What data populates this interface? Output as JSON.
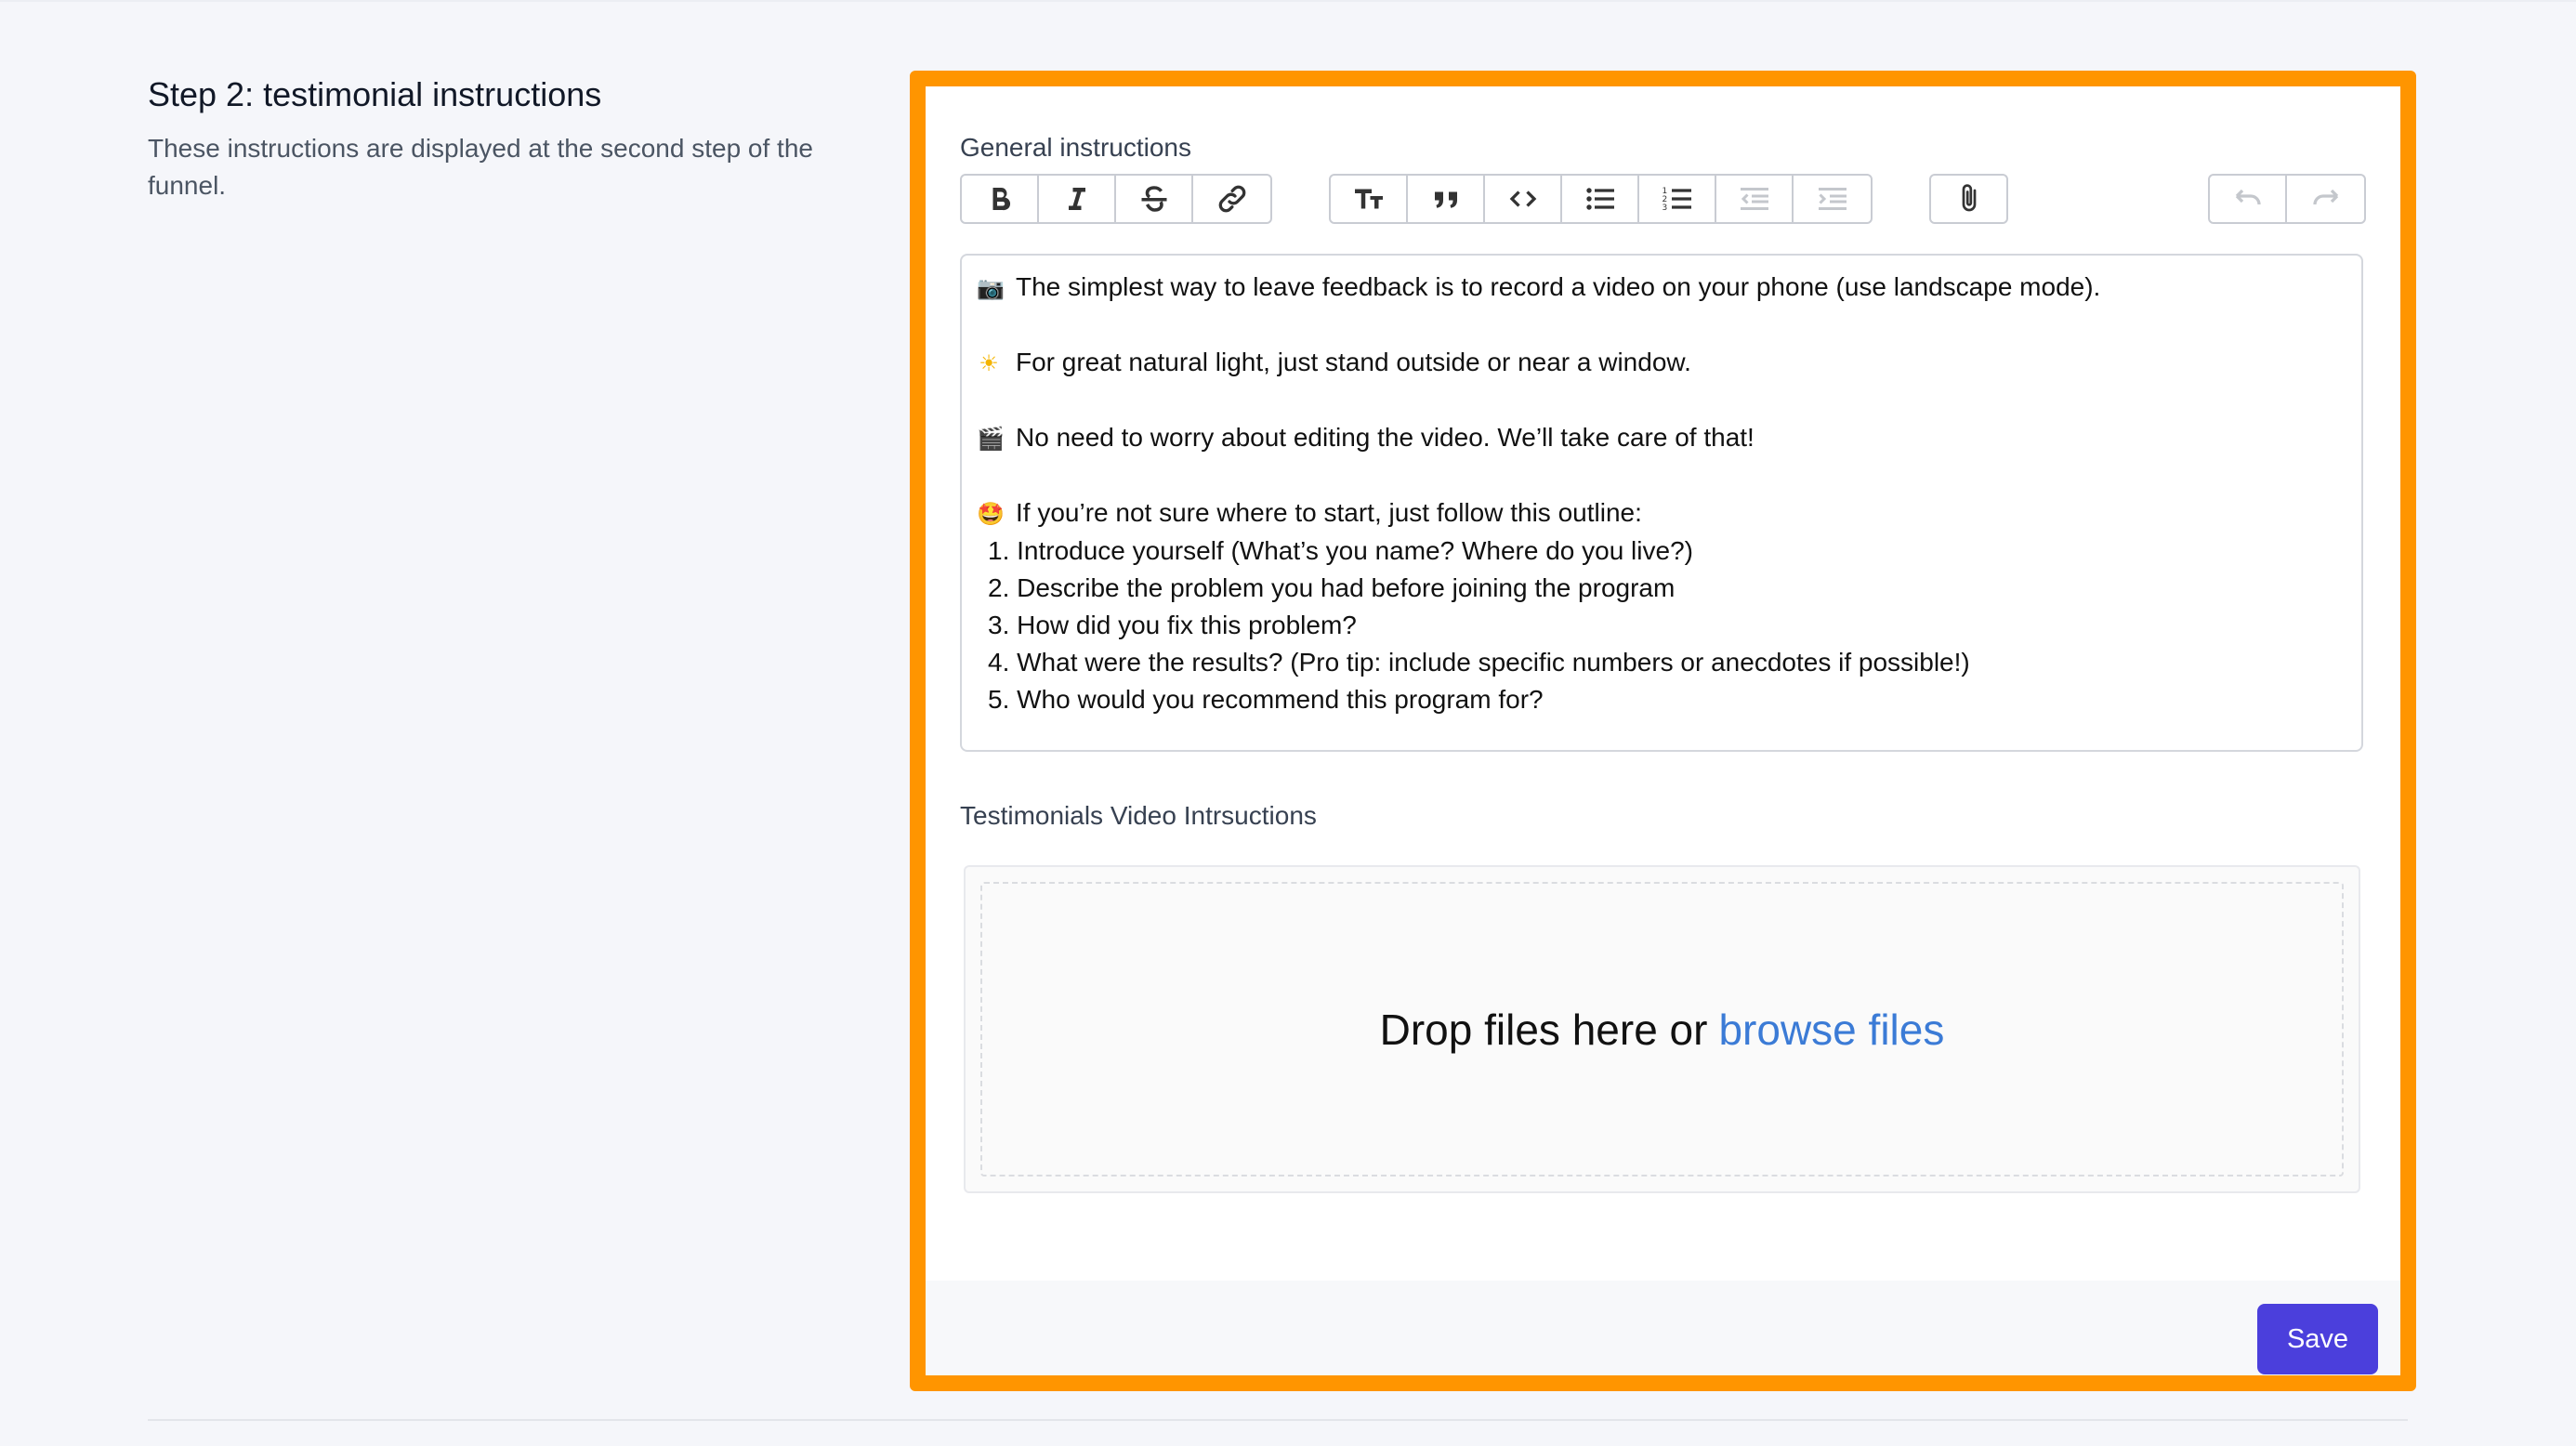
{
  "section": {
    "title": "Step 2: testimonial instructions",
    "description": "These instructions are displayed at the second step of the funnel."
  },
  "general": {
    "label": "General instructions"
  },
  "toolbar": {
    "groups": [
      [
        "bold-icon",
        "italic-icon",
        "strikethrough-icon",
        "link-icon"
      ],
      [
        "heading-icon",
        "quote-icon",
        "code-icon",
        "bullet-list-icon",
        "numbered-list-icon",
        "outdent-icon",
        "indent-icon"
      ],
      [
        "attach-icon"
      ],
      [
        "undo-icon",
        "redo-icon"
      ]
    ]
  },
  "editor": {
    "line1": "The simplest way to leave feedback is to record a video on your phone (use landscape mode).",
    "line2": "For great natural light, just stand outside or near a window.",
    "line3": "No need to worry about editing the video. We’ll take care of that!",
    "line4": "If you’re not sure where to start, just follow this outline:",
    "list": [
      "1. Introduce yourself (What’s you name? Where do you live?)",
      "2. Describe the problem you had before joining the program",
      "3. How did you fix this problem?",
      "4. What were the results? (Pro tip: include specific numbers or anecdotes if possible!)",
      "5. Who would you recommend this program for?"
    ],
    "emoji": {
      "camera": "📷",
      "sun": "☀",
      "clapper": "🎬",
      "starstruck": "🤩"
    }
  },
  "video": {
    "label": "Testimonials Video Intrsuctions",
    "drop_text": "Drop files here or",
    "browse_text": "browse files"
  },
  "footer": {
    "save_label": "Save"
  },
  "colors": {
    "highlight": "#ff9500",
    "primary": "#4b3fdc",
    "link": "#3b7bd6"
  }
}
